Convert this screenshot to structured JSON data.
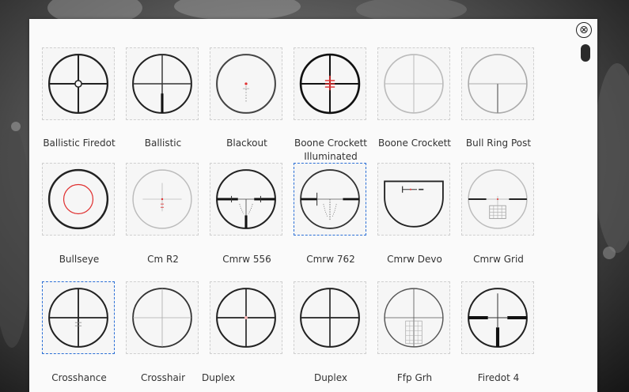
{
  "dialog": {
    "close_glyph": "⊗",
    "close_icon": "close-circle-icon"
  },
  "reticles": [
    {
      "label": "Ballistic Firedot",
      "icon": "ballistic-firedot-reticle-icon"
    },
    {
      "label": "Ballistic",
      "icon": "ballistic-reticle-icon"
    },
    {
      "label": "Blackout",
      "icon": "blackout-reticle-icon"
    },
    {
      "label": "Boone Crockett Illuminated",
      "icon": "boone-crockett-illuminated-reticle-icon"
    },
    {
      "label": "Boone Crockett",
      "icon": "boone-crockett-reticle-icon"
    },
    {
      "label": "Bull Ring Post",
      "icon": "bull-ring-post-reticle-icon"
    },
    {
      "label": "Bullseye",
      "icon": "bullseye-reticle-icon"
    },
    {
      "label": "Cm R2",
      "icon": "cm-r2-reticle-icon"
    },
    {
      "label": "Cmrw 556",
      "icon": "cmrw-556-reticle-icon"
    },
    {
      "label": "Cmrw 762",
      "icon": "cmrw-762-reticle-icon",
      "selected": true
    },
    {
      "label": "Cmrw Devo",
      "icon": "cmrw-devo-reticle-icon"
    },
    {
      "label": "Cmrw Grid",
      "icon": "cmrw-grid-reticle-icon"
    },
    {
      "label": "Crosshance",
      "icon": "crosshance-reticle-icon",
      "selected": true
    },
    {
      "label": "Crosshair",
      "icon": "crosshair-reticle-icon"
    },
    {
      "label": "Duplex",
      "icon": "duplex-reticle-icon"
    },
    {
      "label": "Duplex",
      "icon": "duplex-2-reticle-icon"
    },
    {
      "label": "Ffp Grh",
      "icon": "ffp-grh-reticle-icon"
    },
    {
      "label": "Firedot 4",
      "icon": "firedot-4-reticle-icon"
    }
  ],
  "colors": {
    "selected_border": "#2b6fd6",
    "reticle_red": "#e03030",
    "panel_bg": "#fafafa"
  }
}
